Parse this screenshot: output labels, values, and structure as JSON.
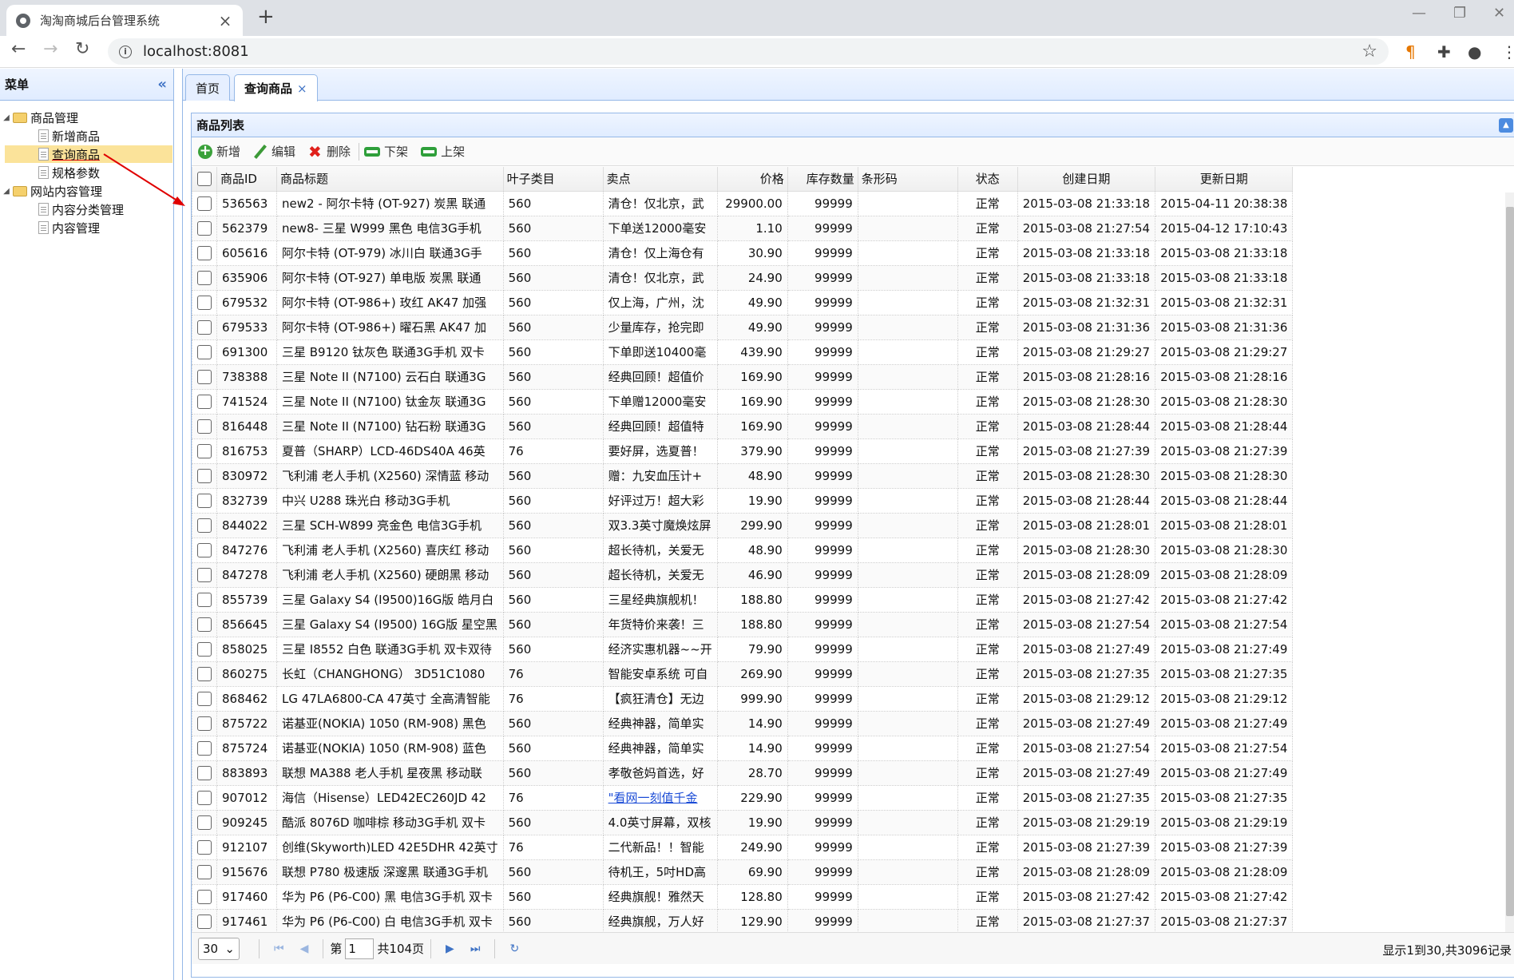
{
  "browser": {
    "tab_title": "淘淘商城后台管理系统",
    "url": "localhost:8081",
    "new_tab": "+",
    "close": "×"
  },
  "sidebar": {
    "title": "菜单",
    "collapse": "«",
    "groups": [
      {
        "label": "商品管理",
        "items": [
          "新增商品",
          "查询商品",
          "规格参数"
        ]
      },
      {
        "label": "网站内容管理",
        "items": [
          "内容分类管理",
          "内容管理"
        ]
      }
    ]
  },
  "tabs": [
    {
      "label": "首页"
    },
    {
      "label": "查询商品",
      "close": "×"
    }
  ],
  "panel": {
    "title": "商品列表"
  },
  "toolbar": {
    "add": "新增",
    "edit": "编辑",
    "delete": "删除",
    "offshelf": "下架",
    "onshelf": "上架"
  },
  "columns": [
    "商品ID",
    "商品标题",
    "叶子类目",
    "卖点",
    "价格",
    "库存数量",
    "条形码",
    "状态",
    "创建日期",
    "更新日期"
  ],
  "rows": [
    [
      "536563",
      "new2 - 阿尔卡特 (OT-927) 炭黑 联通",
      "560",
      "清仓！仅北京，武",
      "29900.00",
      "99999",
      "",
      "正常",
      "2015-03-08 21:33:18",
      "2015-04-11 20:38:38"
    ],
    [
      "562379",
      "new8- 三星 W999 黑色 电信3G手机",
      "560",
      "下单送12000毫安",
      "1.10",
      "99999",
      "",
      "正常",
      "2015-03-08 21:27:54",
      "2015-04-12 17:10:43"
    ],
    [
      "605616",
      "阿尔卡特 (OT-979) 冰川白 联通3G手",
      "560",
      "清仓！仅上海仓有",
      "30.90",
      "99999",
      "",
      "正常",
      "2015-03-08 21:33:18",
      "2015-03-08 21:33:18"
    ],
    [
      "635906",
      "阿尔卡特 (OT-927) 单电版 炭黑 联通",
      "560",
      "清仓！仅北京，武",
      "24.90",
      "99999",
      "",
      "正常",
      "2015-03-08 21:33:18",
      "2015-03-08 21:33:18"
    ],
    [
      "679532",
      "阿尔卡特 (OT-986+) 玫红 AK47 加强",
      "560",
      "仅上海，广州，沈",
      "49.90",
      "99999",
      "",
      "正常",
      "2015-03-08 21:32:31",
      "2015-03-08 21:32:31"
    ],
    [
      "679533",
      "阿尔卡特 (OT-986+) 曜石黑 AK47 加",
      "560",
      "少量库存，抢完即",
      "49.90",
      "99999",
      "",
      "正常",
      "2015-03-08 21:31:36",
      "2015-03-08 21:31:36"
    ],
    [
      "691300",
      "三星 B9120 钛灰色 联通3G手机 双卡",
      "560",
      "下单即送10400毫",
      "439.90",
      "99999",
      "",
      "正常",
      "2015-03-08 21:29:27",
      "2015-03-08 21:29:27"
    ],
    [
      "738388",
      "三星 Note II (N7100) 云石白 联通3G",
      "560",
      "经典回顾！超值价",
      "169.90",
      "99999",
      "",
      "正常",
      "2015-03-08 21:28:16",
      "2015-03-08 21:28:16"
    ],
    [
      "741524",
      "三星 Note II (N7100) 钛金灰 联通3G",
      "560",
      "下单赠12000毫安",
      "169.90",
      "99999",
      "",
      "正常",
      "2015-03-08 21:28:30",
      "2015-03-08 21:28:30"
    ],
    [
      "816448",
      "三星 Note II (N7100) 钻石粉 联通3G",
      "560",
      "经典回顾！超值特",
      "169.90",
      "99999",
      "",
      "正常",
      "2015-03-08 21:28:44",
      "2015-03-08 21:28:44"
    ],
    [
      "816753",
      "夏普（SHARP）LCD-46DS40A 46英",
      "76",
      "要好屏，选夏普！",
      "379.90",
      "99999",
      "",
      "正常",
      "2015-03-08 21:27:39",
      "2015-03-08 21:27:39"
    ],
    [
      "830972",
      "飞利浦 老人手机 (X2560) 深情蓝 移动",
      "560",
      "赠：九安血压计+",
      "48.90",
      "99999",
      "",
      "正常",
      "2015-03-08 21:28:30",
      "2015-03-08 21:28:30"
    ],
    [
      "832739",
      "中兴 U288 珠光白 移动3G手机",
      "560",
      "好评过万！超大彩",
      "19.90",
      "99999",
      "",
      "正常",
      "2015-03-08 21:28:44",
      "2015-03-08 21:28:44"
    ],
    [
      "844022",
      "三星 SCH-W899 亮金色 电信3G手机",
      "560",
      "双3.3英寸魔焕炫屏",
      "299.90",
      "99999",
      "",
      "正常",
      "2015-03-08 21:28:01",
      "2015-03-08 21:28:01"
    ],
    [
      "847276",
      "飞利浦 老人手机 (X2560) 喜庆红 移动",
      "560",
      "超长待机，关爱无",
      "48.90",
      "99999",
      "",
      "正常",
      "2015-03-08 21:28:30",
      "2015-03-08 21:28:30"
    ],
    [
      "847278",
      "飞利浦 老人手机 (X2560) 硬朗黑 移动",
      "560",
      "超长待机，关爱无",
      "46.90",
      "99999",
      "",
      "正常",
      "2015-03-08 21:28:09",
      "2015-03-08 21:28:09"
    ],
    [
      "855739",
      "三星 Galaxy S4 (I9500)16G版 皓月白",
      "560",
      "三星经典旗舰机！",
      "188.80",
      "99999",
      "",
      "正常",
      "2015-03-08 21:27:42",
      "2015-03-08 21:27:42"
    ],
    [
      "856645",
      "三星 Galaxy S4 (I9500) 16G版 星空黑",
      "560",
      "年货特价来袭！三",
      "188.80",
      "99999",
      "",
      "正常",
      "2015-03-08 21:27:54",
      "2015-03-08 21:27:54"
    ],
    [
      "858025",
      "三星 I8552 白色 联通3G手机 双卡双待",
      "560",
      "经济实惠机器~~开",
      "79.90",
      "99999",
      "",
      "正常",
      "2015-03-08 21:27:49",
      "2015-03-08 21:27:49"
    ],
    [
      "860275",
      "长虹（CHANGHONG） 3D51C1080",
      "76",
      "智能安卓系统 可自",
      "269.90",
      "99999",
      "",
      "正常",
      "2015-03-08 21:27:35",
      "2015-03-08 21:27:35"
    ],
    [
      "868462",
      "LG 47LA6800-CA 47英寸 全高清智能",
      "76",
      "【疯狂清仓】无边",
      "999.90",
      "99999",
      "",
      "正常",
      "2015-03-08 21:29:12",
      "2015-03-08 21:29:12"
    ],
    [
      "875722",
      "诺基亚(NOKIA) 1050 (RM-908) 黑色",
      "560",
      "经典神器，简单实",
      "14.90",
      "99999",
      "",
      "正常",
      "2015-03-08 21:27:49",
      "2015-03-08 21:27:49"
    ],
    [
      "875724",
      "诺基亚(NOKIA) 1050 (RM-908) 蓝色",
      "560",
      "经典神器，简单实",
      "14.90",
      "99999",
      "",
      "正常",
      "2015-03-08 21:27:54",
      "2015-03-08 21:27:54"
    ],
    [
      "883893",
      "联想 MA388 老人手机 星夜黑 移动联",
      "560",
      "孝敬爸妈首选，好",
      "28.70",
      "99999",
      "",
      "正常",
      "2015-03-08 21:27:49",
      "2015-03-08 21:27:49"
    ],
    [
      "907012",
      "海信（Hisense）LED42EC260JD 42",
      "76",
      "\"看网一刻值千金",
      "229.90",
      "99999",
      "",
      "正常",
      "2015-03-08 21:27:35",
      "2015-03-08 21:27:35"
    ],
    [
      "909245",
      "酷派 8076D 咖啡棕 移动3G手机 双卡",
      "560",
      "4.0英寸屏幕，双核",
      "19.90",
      "99999",
      "",
      "正常",
      "2015-03-08 21:29:19",
      "2015-03-08 21:29:19"
    ],
    [
      "912107",
      "创维(Skyworth)LED 42E5DHR 42英寸",
      "76",
      "二代新品！！智能",
      "249.90",
      "99999",
      "",
      "正常",
      "2015-03-08 21:27:39",
      "2015-03-08 21:27:39"
    ],
    [
      "915676",
      "联想 P780 极速版 深邃黑 联通3G手机",
      "560",
      "待机王，5吋HD高",
      "69.90",
      "99999",
      "",
      "正常",
      "2015-03-08 21:28:09",
      "2015-03-08 21:28:09"
    ],
    [
      "917460",
      "华为 P6 (P6-C00) 黑 电信3G手机 双卡",
      "560",
      "经典旗舰！雅然天",
      "128.80",
      "99999",
      "",
      "正常",
      "2015-03-08 21:27:42",
      "2015-03-08 21:27:42"
    ],
    [
      "917461",
      "华为 P6 (P6-C00) 白 电信3G手机 双卡",
      "560",
      "经典旗舰，万人好",
      "129.90",
      "99999",
      "",
      "正常",
      "2015-03-08 21:27:37",
      "2015-03-08 21:27:37"
    ]
  ],
  "pager": {
    "page_size": "30",
    "page_prefix": "第",
    "page_value": "1",
    "page_suffix": "共104页",
    "info": "显示1到30,共3096记录"
  },
  "colors": {
    "border": "#95b8e7",
    "selected": "#fbe39a",
    "arrow": "#e00000",
    "accent": "#3f73c5"
  }
}
